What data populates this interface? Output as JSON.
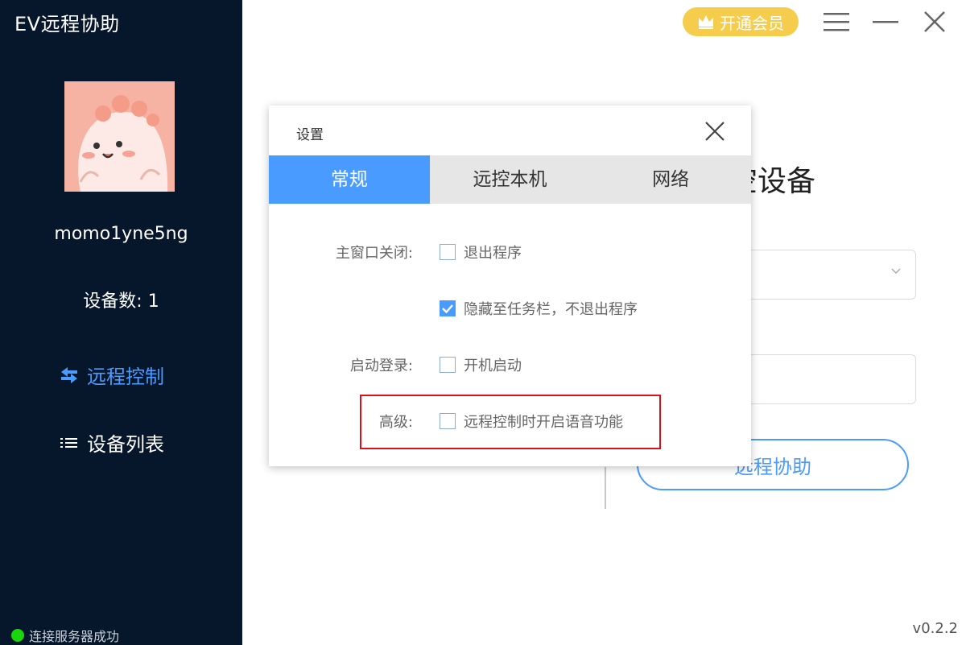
{
  "app": {
    "title": "EV远程协助"
  },
  "sidebar": {
    "username": "momo1yne5ng",
    "device_count": "设备数: 1",
    "nav": [
      {
        "label": "远程控制",
        "icon": "swap-arrows-icon",
        "active": true
      },
      {
        "label": "设备列表",
        "icon": "list-icon",
        "active": false
      }
    ],
    "status": "连接服务器成功"
  },
  "topbar": {
    "vip_label": "开通会员",
    "vip_icon": "crown-icon"
  },
  "main": {
    "heading_partial": "空设备",
    "assist_button": "远程协助"
  },
  "version": "v0.2.2",
  "dialog": {
    "title": "设置",
    "tabs": [
      {
        "label": "常规",
        "active": true
      },
      {
        "label": "远控本机",
        "active": false
      },
      {
        "label": "网络",
        "active": false
      }
    ],
    "rows": [
      {
        "label": "主窗口关闭:",
        "option": "退出程序",
        "checked": false
      },
      {
        "label": "",
        "option": "隐藏至任务栏，不退出程序",
        "checked": true
      },
      {
        "label": "启动登录:",
        "option": "开机启动",
        "checked": false
      },
      {
        "label": "高级:",
        "option": "远程控制时开启语音功能",
        "checked": false
      }
    ]
  },
  "colors": {
    "sidebar_bg": "#06162b",
    "accent": "#4a9bff",
    "vip": "#f5cc4b",
    "status_ok": "#19d60c",
    "highlight": "#e0101a"
  }
}
